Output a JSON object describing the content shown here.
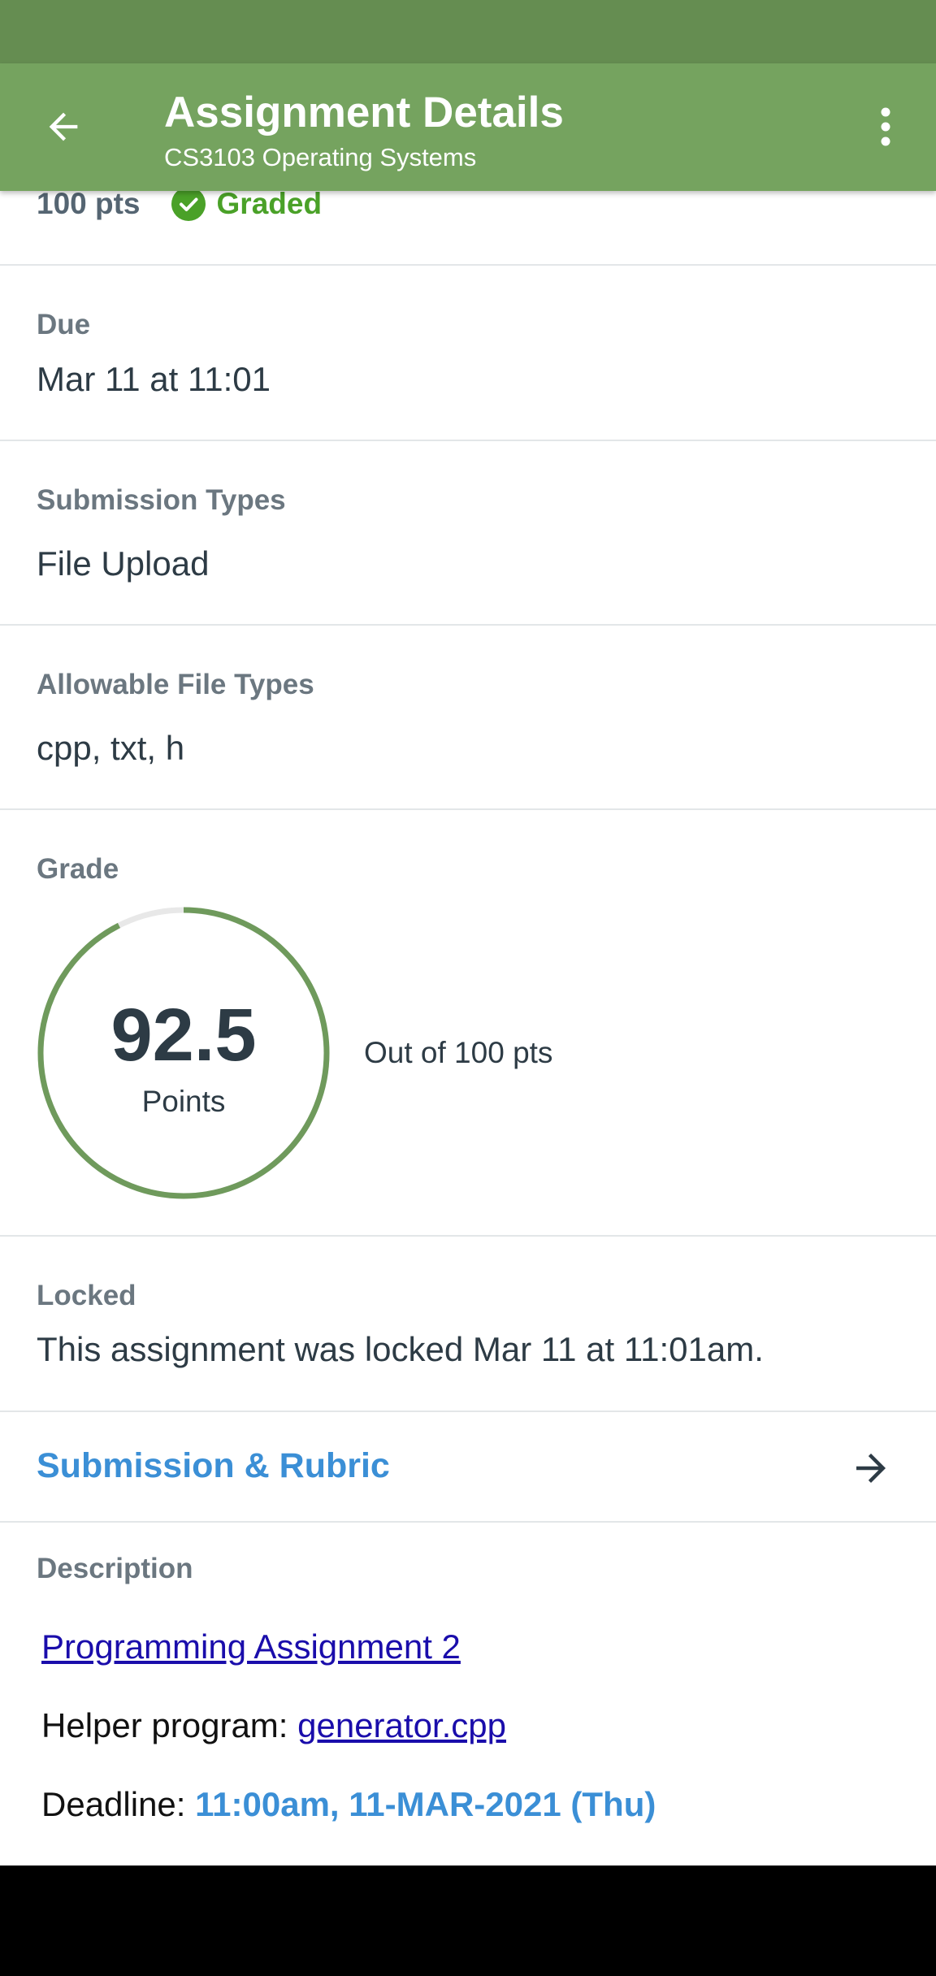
{
  "app_bar": {
    "title": "Assignment Details",
    "subtitle": "CS3103 Operating Systems",
    "back_icon": "arrow-left-icon",
    "menu_icon": "more-vertical-icon"
  },
  "summary": {
    "points": "100 pts",
    "status": "Graded",
    "status_color": "#4aa128"
  },
  "due": {
    "label": "Due",
    "value": "Mar 11 at 11:01"
  },
  "submission_types": {
    "label": "Submission Types",
    "value": "File Upload"
  },
  "file_types": {
    "label": "Allowable File Types",
    "value": "cpp, txt, h"
  },
  "grade": {
    "label": "Grade",
    "score": "92.5",
    "unit": "Points",
    "out_of": "Out of 100 pts",
    "fraction": 0.925,
    "ring_color": "#6f9a5c"
  },
  "locked": {
    "label": "Locked",
    "value": "This assignment was locked Mar 11 at 11:01am."
  },
  "rubric": {
    "label": "Submission & Rubric"
  },
  "description": {
    "label": "Description",
    "assignment_link": "Programming Assignment 2",
    "helper_prefix": "Helper program: ",
    "helper_link": "generator.cpp",
    "deadline_prefix": "Deadline: ",
    "deadline_value": "11:00am, 11-MAR-2021 (Thu)"
  }
}
